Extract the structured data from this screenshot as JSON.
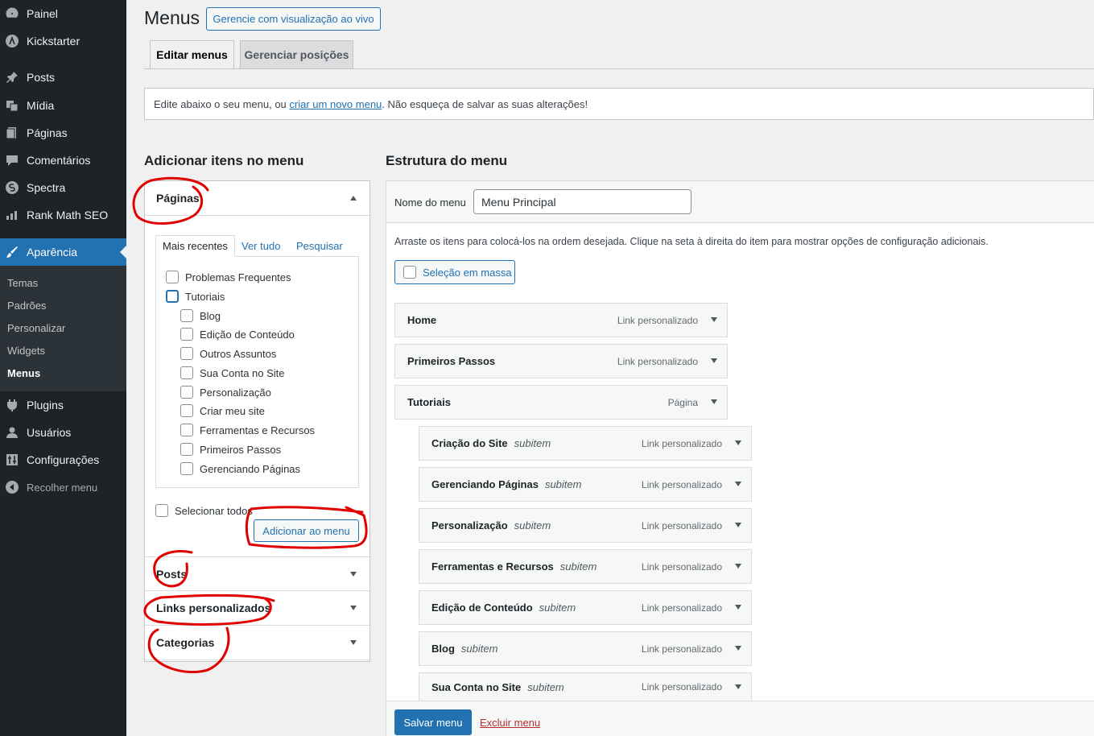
{
  "sidebar": {
    "items": [
      {
        "label": "Painel",
        "icon": "dashboard-icon"
      },
      {
        "label": "Kickstarter",
        "icon": "kickstarter-icon"
      },
      {
        "label": "Posts",
        "icon": "pin-icon"
      },
      {
        "label": "Mídia",
        "icon": "media-icon"
      },
      {
        "label": "Páginas",
        "icon": "pages-icon"
      },
      {
        "label": "Comentários",
        "icon": "comment-icon"
      },
      {
        "label": "Spectra",
        "icon": "spectra-icon"
      },
      {
        "label": "Rank Math SEO",
        "icon": "chart-icon"
      },
      {
        "label": "Aparência",
        "icon": "brush-icon"
      },
      {
        "label": "Plugins",
        "icon": "plugin-icon"
      },
      {
        "label": "Usuários",
        "icon": "user-icon"
      },
      {
        "label": "Configurações",
        "icon": "settings-icon"
      },
      {
        "label": "Recolher menu",
        "icon": "collapse-icon"
      }
    ],
    "submenu": [
      "Temas",
      "Padrões",
      "Personalizar",
      "Widgets",
      "Menus"
    ]
  },
  "header": {
    "title": "Menus",
    "live_button": "Gerencie com visualização ao vivo",
    "tabs": [
      "Editar menus",
      "Gerenciar posições"
    ]
  },
  "notice": {
    "before": "Edite abaixo o seu menu, ou ",
    "link": "criar um novo menu",
    "after": ". Não esqueça de salvar as suas alterações!"
  },
  "left": {
    "heading": "Adicionar itens no menu",
    "sections": [
      "Páginas",
      "Posts",
      "Links personalizados",
      "Categorias"
    ],
    "subtabs": [
      "Mais recentes",
      "Ver tudo",
      "Pesquisar"
    ],
    "pages": [
      {
        "label": "Problemas Frequentes",
        "indent": 0
      },
      {
        "label": "Tutoriais",
        "indent": 0
      },
      {
        "label": "Blog",
        "indent": 1
      },
      {
        "label": "Edição de Conteúdo",
        "indent": 1
      },
      {
        "label": "Outros Assuntos",
        "indent": 1
      },
      {
        "label": "Sua Conta no Site",
        "indent": 1
      },
      {
        "label": "Personalização",
        "indent": 1
      },
      {
        "label": "Criar meu site",
        "indent": 1
      },
      {
        "label": "Ferramentas e Recursos",
        "indent": 1
      },
      {
        "label": "Primeiros Passos",
        "indent": 1
      },
      {
        "label": "Gerenciando Páginas",
        "indent": 1
      }
    ],
    "select_all": "Selecionar todos",
    "add_button": "Adicionar ao menu"
  },
  "right": {
    "heading": "Estrutura do menu",
    "name_label": "Nome do menu",
    "name_value": "Menu Principal",
    "hint": "Arraste os itens para colocá-los na ordem desejada. Clique na seta à direita do item para mostrar opções de configuração adicionais.",
    "bulk": "Seleção em massa",
    "items": [
      {
        "title": "Home",
        "type": "Link personalizado",
        "sub": ""
      },
      {
        "title": "Primeiros Passos",
        "type": "Link personalizado",
        "sub": ""
      },
      {
        "title": "Tutoriais",
        "type": "Página",
        "sub": ""
      },
      {
        "title": "Criação do Site",
        "type": "Link personalizado",
        "sub": "subitem"
      },
      {
        "title": "Gerenciando Páginas",
        "type": "Link personalizado",
        "sub": "subitem"
      },
      {
        "title": "Personalização",
        "type": "Link personalizado",
        "sub": "subitem"
      },
      {
        "title": "Ferramentas e Recursos",
        "type": "Link personalizado",
        "sub": "subitem"
      },
      {
        "title": "Edição de Conteúdo",
        "type": "Link personalizado",
        "sub": "subitem"
      },
      {
        "title": "Blog",
        "type": "Link personalizado",
        "sub": "subitem"
      },
      {
        "title": "Sua Conta no Site",
        "type": "Link personalizado",
        "sub": "subitem"
      }
    ],
    "save": "Salvar menu",
    "delete": "Excluir menu"
  },
  "colors": {
    "admin_bar": "#1d2327",
    "accent": "#2271b1",
    "annotation": "#e00000",
    "danger": "#b32d2e"
  }
}
